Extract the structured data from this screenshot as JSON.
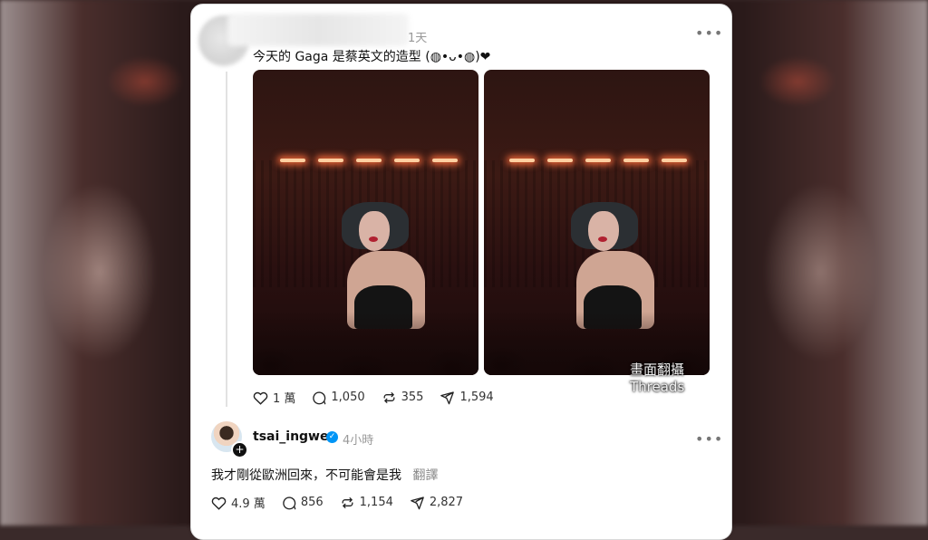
{
  "post": {
    "time": "1天",
    "text": "今天的 Gaga 是蔡英文的造型 (◍•ᴗ•◍)❤",
    "watermark": "畫面翻攝 Threads",
    "stats": {
      "likes": "1 萬",
      "comments": "1,050",
      "reposts": "355",
      "shares": "1,594"
    }
  },
  "reply": {
    "username": "tsai_ingwen",
    "time": "4小時",
    "text": "我才剛從歐洲回來，不可能會是我",
    "translate": "翻譯",
    "stats": {
      "likes": "4.9 萬",
      "comments": "856",
      "reposts": "1,154",
      "shares": "2,827"
    }
  },
  "icons": {
    "more": "more-horizontal-icon",
    "like": "heart-icon",
    "comment": "comment-bubble-icon",
    "repost": "repost-icon",
    "share": "send-icon",
    "verified": "verified-badge-icon"
  },
  "colors": {
    "verified": "#0095f6",
    "muted": "#999999"
  }
}
